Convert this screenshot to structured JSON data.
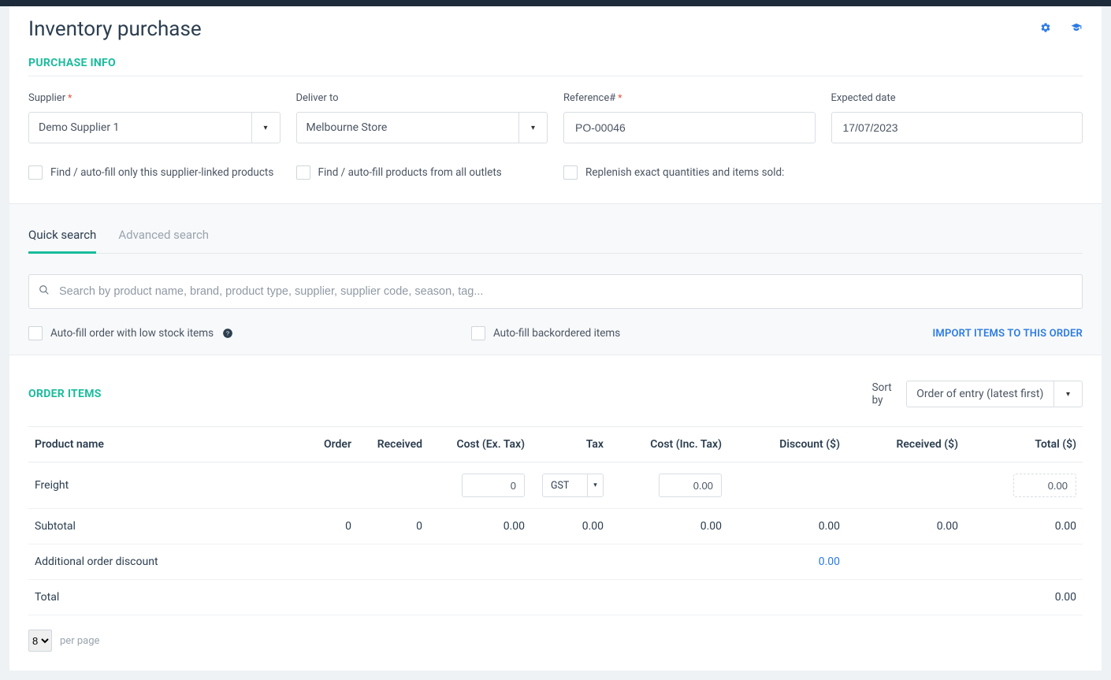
{
  "header": {
    "title": "Inventory purchase"
  },
  "purchase": {
    "sectionTitle": "PURCHASE INFO",
    "supplierLabel": "Supplier",
    "supplierValue": "Demo Supplier 1",
    "deliverLabel": "Deliver to",
    "deliverValue": "Melbourne Store",
    "referenceLabel": "Reference#",
    "referenceValue": "PO-00046",
    "expectedLabel": "Expected date",
    "expectedValue": "17/07/2023",
    "chkSupplierLinked": "Find / auto-fill only this supplier-linked products",
    "chkAllOutlets": "Find / auto-fill products from all outlets",
    "chkReplenish": "Replenish exact quantities and items sold:"
  },
  "search": {
    "tabQuick": "Quick search",
    "tabAdvanced": "Advanced search",
    "placeholder": "Search by product name, brand, product type, supplier, supplier code, season, tag...",
    "chkLowStock": "Auto-fill order with low stock items",
    "chkBackordered": "Auto-fill backordered items",
    "importLink": "IMPORT ITEMS TO THIS ORDER"
  },
  "order": {
    "sectionTitle": "ORDER ITEMS",
    "sortByLabel": "Sort by",
    "sortByValue": "Order of entry (latest first)",
    "cols": {
      "name": "Product name",
      "order": "Order",
      "received": "Received",
      "costEx": "Cost (Ex. Tax)",
      "tax": "Tax",
      "costInc": "Cost (Inc. Tax)",
      "discount": "Discount ($)",
      "receivedAmt": "Received ($)",
      "total": "Total ($)"
    },
    "freight": {
      "label": "Freight",
      "costEx": "0",
      "taxSel": "GST",
      "costInc": "0.00",
      "total": "0.00"
    },
    "subtotal": {
      "label": "Subtotal",
      "order": "0",
      "received": "0",
      "costEx": "0.00",
      "tax": "0.00",
      "costInc": "0.00",
      "discount": "0.00",
      "receivedAmt": "0.00",
      "total": "0.00"
    },
    "additional": {
      "label": "Additional order discount",
      "discount": "0.00"
    },
    "total": {
      "label": "Total",
      "total": "0.00"
    },
    "pager": {
      "size": "8",
      "perPage": "per page"
    }
  }
}
